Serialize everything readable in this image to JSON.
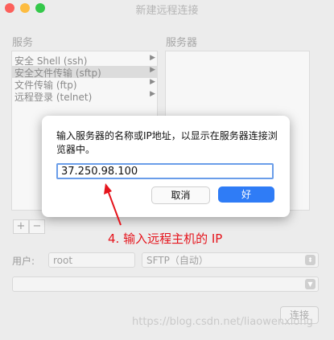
{
  "window": {
    "title": "新建远程连接"
  },
  "services": {
    "label": "服务",
    "items": [
      {
        "label": "安全 Shell (ssh)",
        "selected": false
      },
      {
        "label": "安全文件传输 (sftp)",
        "selected": true
      },
      {
        "label": "文件传输 (ftp)",
        "selected": false
      },
      {
        "label": "远程登录 (telnet)",
        "selected": false
      }
    ]
  },
  "servers": {
    "label": "服务器"
  },
  "buttons": {
    "add": "+",
    "remove": "−",
    "connect": "连接"
  },
  "user": {
    "label": "用户:",
    "value": "root"
  },
  "protocol": {
    "value": "SFTP（自动）"
  },
  "dialog": {
    "message": "输入服务器的名称或IP地址，以显示在服务器连接浏览器中。",
    "input_value": "37.250.98.100",
    "cancel_label": "取消",
    "ok_label": "好"
  },
  "annotation": {
    "text": "4. 输入远程主机的 IP",
    "color": "#e5141c"
  },
  "watermark": {
    "text": "https://blog.csdn.net/liaowenxiong"
  }
}
